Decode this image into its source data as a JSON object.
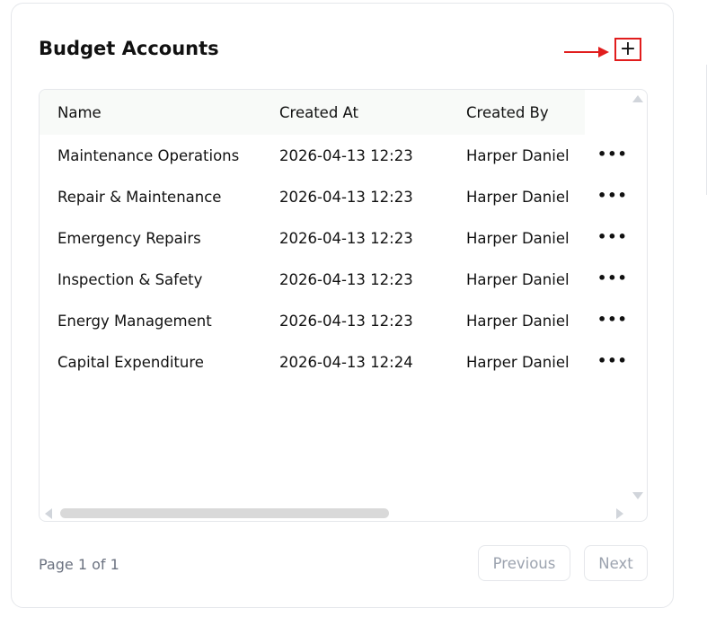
{
  "header": {
    "title": "Budget Accounts",
    "add_label": "+"
  },
  "table": {
    "columns": [
      "Name",
      "Created At",
      "Created By"
    ],
    "rows": [
      {
        "name": "Maintenance Operations",
        "created_at": "2026-04-13 12:23",
        "created_by": "Harper Daniel",
        "actions": "•••"
      },
      {
        "name": "Repair & Maintenance",
        "created_at": "2026-04-13 12:23",
        "created_by": "Harper Daniel",
        "actions": "•••"
      },
      {
        "name": "Emergency Repairs",
        "created_at": "2026-04-13 12:23",
        "created_by": "Harper Daniel",
        "actions": "•••"
      },
      {
        "name": "Inspection & Safety",
        "created_at": "2026-04-13 12:23",
        "created_by": "Harper Daniel",
        "actions": "•••"
      },
      {
        "name": "Energy Management",
        "created_at": "2026-04-13 12:23",
        "created_by": "Harper Daniel",
        "actions": "•••"
      },
      {
        "name": "Capital Expenditure",
        "created_at": "2026-04-13 12:24",
        "created_by": "Harper Daniel",
        "actions": "•••"
      }
    ]
  },
  "pagination": {
    "page_info": "Page 1 of 1",
    "previous_label": "Previous",
    "next_label": "Next"
  },
  "colors": {
    "highlight": "#e11d1d",
    "header_bg": "#f8faf8",
    "muted_text": "#9ca3af"
  }
}
